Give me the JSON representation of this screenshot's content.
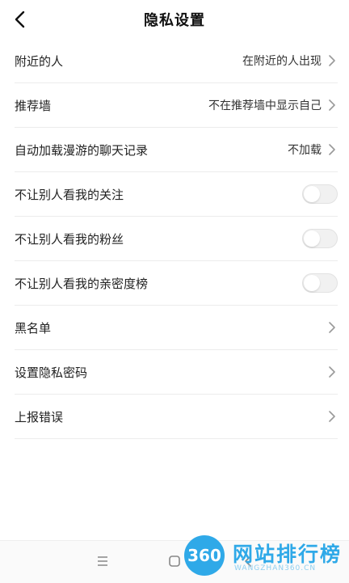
{
  "header": {
    "title": "隐私设置",
    "back_icon": "chevron-left-icon"
  },
  "rows": [
    {
      "label": "附近的人",
      "value": "在附近的人出现",
      "control": "chevron"
    },
    {
      "label": "推荐墙",
      "value": "不在推荐墙中显示自己",
      "control": "chevron"
    },
    {
      "label": "自动加载漫游的聊天记录",
      "value": "不加载",
      "control": "chevron"
    },
    {
      "label": "不让别人看我的关注",
      "control": "toggle",
      "on": false
    },
    {
      "label": "不让别人看我的粉丝",
      "control": "toggle",
      "on": false
    },
    {
      "label": "不让别人看我的亲密度榜",
      "control": "toggle",
      "on": false
    },
    {
      "label": "黑名单",
      "control": "chevron"
    },
    {
      "label": "设置隐私密码",
      "control": "chevron"
    },
    {
      "label": "上报错误",
      "control": "chevron"
    }
  ],
  "system_nav": {
    "icons": [
      "menu-icon",
      "home-icon",
      "back-icon"
    ]
  },
  "watermark": {
    "logo_text": "360",
    "name": "网站排行榜",
    "sub": "WANGZHAN360.CN"
  },
  "colors": {
    "toggle_off": "#f1f1f1",
    "watermark": "#2fa9e8",
    "divider": "#ececec"
  }
}
